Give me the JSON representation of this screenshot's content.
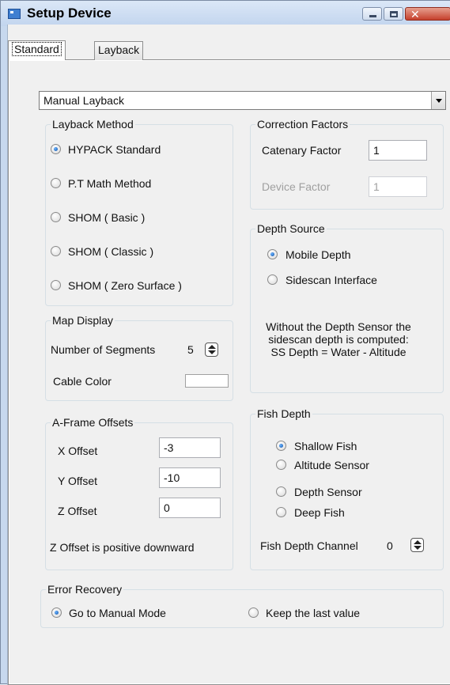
{
  "window": {
    "title": "Setup Device",
    "controls": {
      "minimize": "minimize",
      "maximize": "maximize",
      "close": "✕"
    }
  },
  "tabs": [
    {
      "label": "Standard",
      "active": true
    },
    {
      "label": "Layback",
      "active": false
    }
  ],
  "layback_mode": {
    "value": "Manual Layback"
  },
  "layback_method": {
    "legend": "Layback Method",
    "options": [
      {
        "label": "HYPACK Standard",
        "checked": true
      },
      {
        "label": "P.T Math Method",
        "checked": false
      },
      {
        "label": "SHOM ( Basic )",
        "checked": false
      },
      {
        "label": "SHOM ( Classic )",
        "checked": false
      },
      {
        "label": "SHOM ( Zero Surface )",
        "checked": false
      }
    ]
  },
  "correction_factors": {
    "legend": "Correction Factors",
    "catenary_label": "Catenary Factor",
    "catenary_value": "1",
    "device_label": "Device Factor",
    "device_value": "1"
  },
  "depth_source": {
    "legend": "Depth Source",
    "options": [
      {
        "label": "Mobile Depth",
        "checked": true
      },
      {
        "label": "Sidescan Interface",
        "checked": false
      }
    ],
    "note": "Without the Depth Sensor the\nsidescan depth is computed:\nSS Depth = Water - Altitude"
  },
  "map_display": {
    "legend": "Map Display",
    "segments_label": "Number of Segments",
    "segments_value": "5",
    "cable_color_label": "Cable Color"
  },
  "aframe_offsets": {
    "legend": "A-Frame Offsets",
    "x_label": "X Offset",
    "x_value": "-3",
    "y_label": "Y Offset",
    "y_value": "-10",
    "z_label": "Z Offset",
    "z_value": "0",
    "note": "Z Offset is positive downward"
  },
  "fish_depth": {
    "legend": "Fish Depth",
    "options": [
      {
        "label": "Shallow Fish",
        "checked": true
      },
      {
        "label": "Altitude Sensor",
        "checked": false
      },
      {
        "label": "Depth Sensor",
        "checked": false
      },
      {
        "label": "Deep Fish",
        "checked": false
      }
    ],
    "channel_label": "Fish Depth Channel",
    "channel_value": "0"
  },
  "error_recovery": {
    "legend": "Error Recovery",
    "options": [
      {
        "label": "Go to Manual Mode",
        "checked": true
      },
      {
        "label": "Keep the last value",
        "checked": false
      }
    ]
  }
}
